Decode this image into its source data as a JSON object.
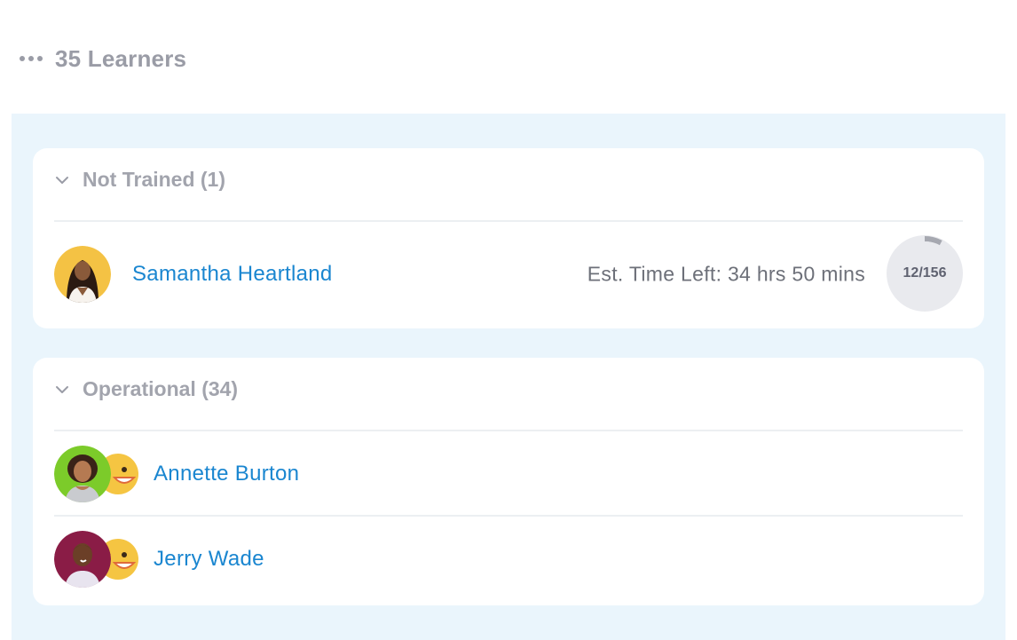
{
  "header": {
    "count_label": "35 Learners",
    "menu_icon": "more-horizontal-icon"
  },
  "groups": [
    {
      "title": "Not Trained (1)",
      "learners": [
        {
          "name": "Samantha Heartland",
          "est_time": "Est. Time Left: 34 hrs 50 mins",
          "progress_label": "12/156",
          "progress_fraction": 0.077
        }
      ]
    },
    {
      "title": "Operational (34)",
      "learners": [
        {
          "name": "Annette Burton",
          "status_icon": "happy-emoji-icon"
        },
        {
          "name": "Jerry Wade",
          "status_icon": "happy-emoji-icon"
        }
      ]
    }
  ],
  "colors": {
    "panel_bg": "#eaf5fc",
    "name_link": "#1a86d0",
    "muted_text": "#9a9ca6",
    "progress_track": "#e9eaee",
    "progress_fill": "#a6a8b0",
    "emoji": "#f5c542"
  }
}
